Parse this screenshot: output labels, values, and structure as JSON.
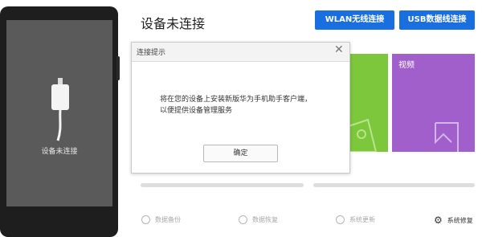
{
  "phone": {
    "status_label": "设备未连接"
  },
  "header": {
    "title": "设备未连接",
    "wlan_button": "WLAN无线连接",
    "usb_button": "USB数据线连接"
  },
  "tiles": {
    "video_label": "视频"
  },
  "toolbar": {
    "items": [
      {
        "label": "数据备份",
        "icon": "clock-backup-icon"
      },
      {
        "label": "数据恢复",
        "icon": "restore-icon"
      },
      {
        "label": "系统更新",
        "icon": "update-arrow-icon"
      },
      {
        "label": "系统修复",
        "icon": "gear-icon"
      }
    ]
  },
  "dialog": {
    "title": "连接提示",
    "message_line1": "将在您的设备上安装新版华为手机助手客户端，",
    "message_line2": "以便提供设备管理服务",
    "ok_button": "确定"
  },
  "colors": {
    "accent": "#1a6fe0",
    "tile_green": "#7cc73b",
    "tile_purple": "#a05fcb"
  }
}
